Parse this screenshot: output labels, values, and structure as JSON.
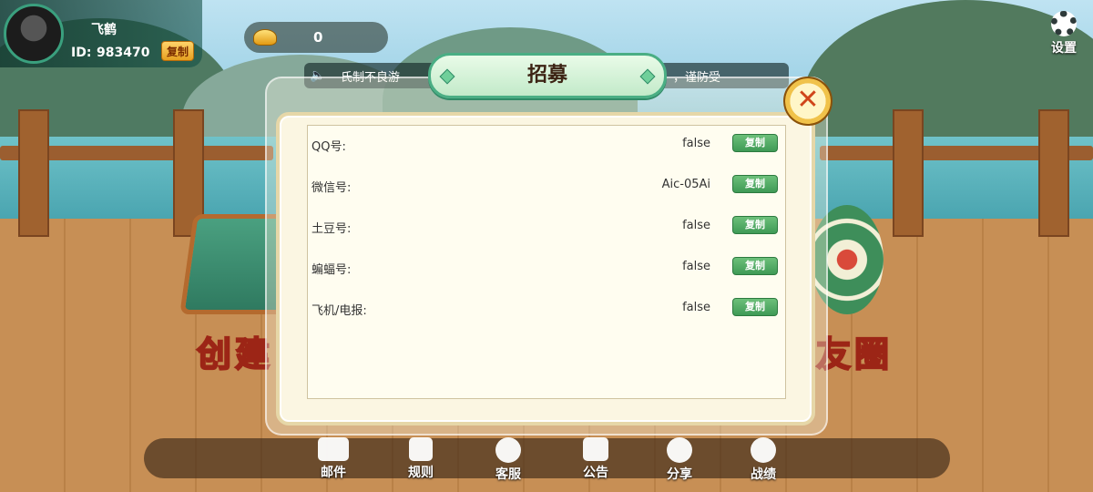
{
  "profile": {
    "nickname": "飞鹤",
    "id_label": "ID:",
    "id_value": "983470",
    "copy_label": "复制"
  },
  "gold": {
    "value": "0",
    "icon": "gold-ingot-icon"
  },
  "settings": {
    "label": "设置",
    "icon": "gear-icon"
  },
  "marquee": {
    "text_left": "氏制不良游",
    "text_right": "，谨防受"
  },
  "dialog": {
    "title": "招募",
    "close_icon": "close-icon",
    "rows": [
      {
        "label": "QQ号:",
        "value": "false",
        "copy_label": "复制"
      },
      {
        "label": "微信号:",
        "value": "Aic-05Ai",
        "copy_label": "复制"
      },
      {
        "label": "土豆号:",
        "value": "false",
        "copy_label": "复制"
      },
      {
        "label": "蝙蝠号:",
        "value": "false",
        "copy_label": "复制"
      },
      {
        "label": "飞机/电报:",
        "value": "false",
        "copy_label": "复制"
      }
    ]
  },
  "background_text": {
    "left": "创建",
    "right": "友圈"
  },
  "bottom_nav": [
    {
      "label": "邮件",
      "icon": "mail-icon"
    },
    {
      "label": "规则",
      "icon": "rules-icon"
    },
    {
      "label": "客服",
      "icon": "customer-service-icon"
    },
    {
      "label": "公告",
      "icon": "announcement-icon"
    },
    {
      "label": "分享",
      "icon": "share-icon"
    },
    {
      "label": "战绩",
      "icon": "record-icon"
    }
  ],
  "colors": {
    "accent_green": "#4aae84",
    "copy_gold": "#e6a020",
    "copy_green": "#3f9a56"
  }
}
